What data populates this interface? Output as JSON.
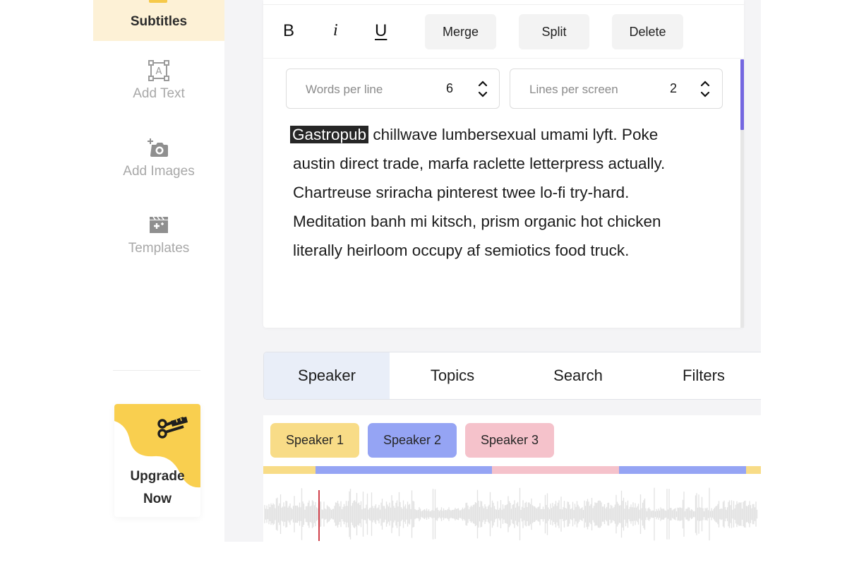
{
  "sidebar": {
    "active_item": {
      "label": "Subtitles",
      "icon": "subtitles-icon"
    },
    "items": [
      {
        "label": "Add Text",
        "icon": "text-box-icon"
      },
      {
        "label": "Add Images",
        "icon": "add-camera-icon"
      },
      {
        "label": "Templates",
        "icon": "clapperboard-icon"
      }
    ],
    "upgrade": {
      "line1": "Upgrade",
      "line2": "Now",
      "icon": "scissors-film-icon"
    }
  },
  "editor": {
    "format_buttons": {
      "bold": "B",
      "italic": "i",
      "underline": "U"
    },
    "actions": {
      "merge": "Merge",
      "split": "Split",
      "delete": "Delete"
    },
    "words_per_line": {
      "label": "Words per line",
      "value": "6"
    },
    "lines_per_screen": {
      "label": "Lines per screen",
      "value": "2"
    },
    "highlighted_word": "Gastropub",
    "text_lines": [
      " chillwave lumbersexual umami lyft. Poke",
      "austin direct trade, marfa raclette letterpress actually.",
      "Chartreuse sriracha pinterest twee lo-fi try-hard.",
      "Meditation banh mi kitsch, prism organic hot chicken",
      "literally heirloom occupy af semiotics food truck."
    ]
  },
  "tabs": [
    {
      "label": "Speaker",
      "active": true
    },
    {
      "label": "Topics",
      "active": false
    },
    {
      "label": "Search",
      "active": false
    },
    {
      "label": "Filters",
      "active": false
    }
  ],
  "speakers": [
    {
      "label": "Speaker 1",
      "color": "#f8dc87"
    },
    {
      "label": "Speaker 2",
      "color": "#95a4f4"
    },
    {
      "label": "Speaker 3",
      "color": "#f5c2cb"
    }
  ],
  "timeline_segments": [
    {
      "speaker": 0,
      "start_pct": 0,
      "end_pct": 10.5
    },
    {
      "speaker": 1,
      "start_pct": 10.5,
      "end_pct": 46
    },
    {
      "speaker": 2,
      "start_pct": 46,
      "end_pct": 71.5
    },
    {
      "speaker": 1,
      "start_pct": 71.5,
      "end_pct": 97
    },
    {
      "speaker": 0,
      "start_pct": 97,
      "end_pct": 100
    }
  ],
  "playhead_pct": 11,
  "colors": {
    "accent": "#7467e0",
    "sidebar_active_bg": "#fdf1d6",
    "upgrade_yellow": "#f9cf4f",
    "playhead": "#d0404a"
  }
}
